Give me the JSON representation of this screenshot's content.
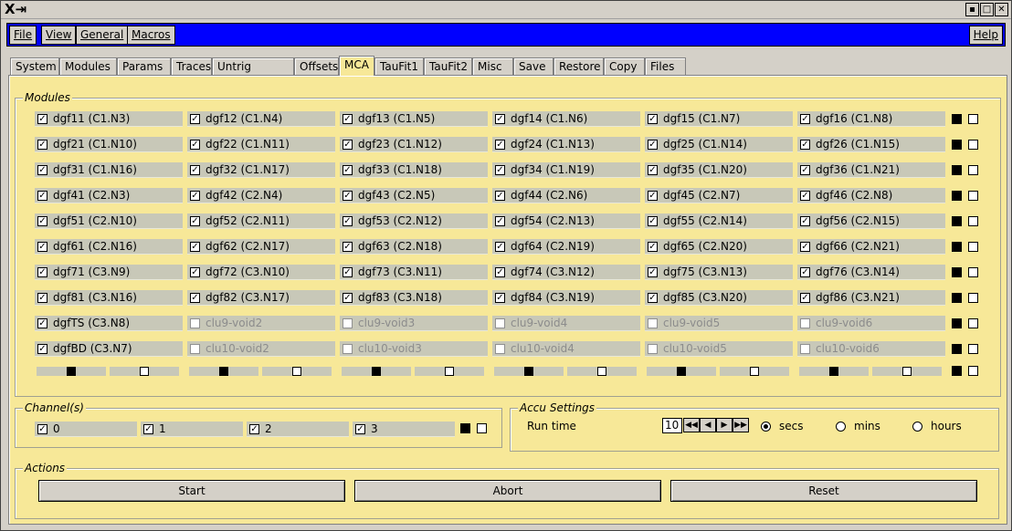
{
  "window": {
    "title_glyph": "X⇥",
    "ctl_iconify": "▪",
    "ctl_maximize": "□",
    "ctl_close": "✕"
  },
  "menubar": {
    "items": [
      {
        "label": "File"
      },
      {
        "label": "View"
      },
      {
        "label": "General"
      },
      {
        "label": "Macros"
      }
    ],
    "help": "Help"
  },
  "tabs": [
    {
      "label": "System"
    },
    {
      "label": "Modules"
    },
    {
      "label": "Params"
    },
    {
      "label": "Traces"
    },
    {
      "label": "Untrig Traces"
    },
    {
      "label": "Offsets"
    },
    {
      "label": "MCA",
      "active": true
    },
    {
      "label": "TauFit1"
    },
    {
      "label": "TauFit2"
    },
    {
      "label": "Misc"
    },
    {
      "label": "Save"
    },
    {
      "label": "Restore"
    },
    {
      "label": "Copy"
    },
    {
      "label": "Files"
    }
  ],
  "modules": {
    "legend": "Modules",
    "rows": [
      [
        {
          "label": "dgf11 (C1.N3)",
          "checked": true
        },
        {
          "label": "dgf12 (C1.N4)",
          "checked": true
        },
        {
          "label": "dgf13 (C1.N5)",
          "checked": true
        },
        {
          "label": "dgf14 (C1.N6)",
          "checked": true
        },
        {
          "label": "dgf15 (C1.N7)",
          "checked": true
        },
        {
          "label": "dgf16 (C1.N8)",
          "checked": true
        }
      ],
      [
        {
          "label": "dgf21 (C1.N10)",
          "checked": true
        },
        {
          "label": "dgf22 (C1.N11)",
          "checked": true
        },
        {
          "label": "dgf23 (C1.N12)",
          "checked": true
        },
        {
          "label": "dgf24 (C1.N13)",
          "checked": true
        },
        {
          "label": "dgf25 (C1.N14)",
          "checked": true
        },
        {
          "label": "dgf26 (C1.N15)",
          "checked": true
        }
      ],
      [
        {
          "label": "dgf31 (C1.N16)",
          "checked": true
        },
        {
          "label": "dgf32 (C1.N17)",
          "checked": true
        },
        {
          "label": "dgf33 (C1.N18)",
          "checked": true
        },
        {
          "label": "dgf34 (C1.N19)",
          "checked": true
        },
        {
          "label": "dgf35 (C1.N20)",
          "checked": true
        },
        {
          "label": "dgf36 (C1.N21)",
          "checked": true
        }
      ],
      [
        {
          "label": "dgf41 (C2.N3)",
          "checked": true
        },
        {
          "label": "dgf42 (C2.N4)",
          "checked": true
        },
        {
          "label": "dgf43 (C2.N5)",
          "checked": true
        },
        {
          "label": "dgf44 (C2.N6)",
          "checked": true
        },
        {
          "label": "dgf45 (C2.N7)",
          "checked": true
        },
        {
          "label": "dgf46 (C2.N8)",
          "checked": true
        }
      ],
      [
        {
          "label": "dgf51 (C2.N10)",
          "checked": true
        },
        {
          "label": "dgf52 (C2.N11)",
          "checked": true
        },
        {
          "label": "dgf53 (C2.N12)",
          "checked": true
        },
        {
          "label": "dgf54 (C2.N13)",
          "checked": true
        },
        {
          "label": "dgf55 (C2.N14)",
          "checked": true
        },
        {
          "label": "dgf56 (C2.N15)",
          "checked": true
        }
      ],
      [
        {
          "label": "dgf61 (C2.N16)",
          "checked": true
        },
        {
          "label": "dgf62 (C2.N17)",
          "checked": true
        },
        {
          "label": "dgf63 (C2.N18)",
          "checked": true
        },
        {
          "label": "dgf64 (C2.N19)",
          "checked": true
        },
        {
          "label": "dgf65 (C2.N20)",
          "checked": true
        },
        {
          "label": "dgf66 (C2.N21)",
          "checked": true
        }
      ],
      [
        {
          "label": "dgf71 (C3.N9)",
          "checked": true
        },
        {
          "label": "dgf72 (C3.N10)",
          "checked": true
        },
        {
          "label": "dgf73 (C3.N11)",
          "checked": true
        },
        {
          "label": "dgf74 (C3.N12)",
          "checked": true
        },
        {
          "label": "dgf75 (C3.N13)",
          "checked": true
        },
        {
          "label": "dgf76 (C3.N14)",
          "checked": true
        }
      ],
      [
        {
          "label": "dgf81 (C3.N16)",
          "checked": true
        },
        {
          "label": "dgf82 (C3.N17)",
          "checked": true
        },
        {
          "label": "dgf83 (C3.N18)",
          "checked": true
        },
        {
          "label": "dgf84 (C3.N19)",
          "checked": true
        },
        {
          "label": "dgf85 (C3.N20)",
          "checked": true
        },
        {
          "label": "dgf86 (C3.N21)",
          "checked": true
        }
      ],
      [
        {
          "label": "dgfTS (C3.N8)",
          "checked": true
        },
        {
          "label": "clu9-void2",
          "checked": false,
          "disabled": true
        },
        {
          "label": "clu9-void3",
          "checked": false,
          "disabled": true
        },
        {
          "label": "clu9-void4",
          "checked": false,
          "disabled": true
        },
        {
          "label": "clu9-void5",
          "checked": false,
          "disabled": true
        },
        {
          "label": "clu9-void6",
          "checked": false,
          "disabled": true
        }
      ],
      [
        {
          "label": "dgfBD (C3.N7)",
          "checked": true
        },
        {
          "label": "clu10-void2",
          "checked": false,
          "disabled": true
        },
        {
          "label": "clu10-void3",
          "checked": false,
          "disabled": true
        },
        {
          "label": "clu10-void4",
          "checked": false,
          "disabled": true
        },
        {
          "label": "clu10-void5",
          "checked": false,
          "disabled": true
        },
        {
          "label": "clu10-void6",
          "checked": false,
          "disabled": true
        }
      ]
    ]
  },
  "channels": {
    "legend": "Channel(s)",
    "items": [
      {
        "label": "0",
        "checked": true
      },
      {
        "label": "1",
        "checked": true
      },
      {
        "label": "2",
        "checked": true
      },
      {
        "label": "3",
        "checked": true
      }
    ]
  },
  "accu": {
    "legend": "Accu Settings",
    "run_time_label": "Run time",
    "run_time_value": "10",
    "spin_first": "◀◀",
    "spin_prev": "◀",
    "spin_next": "▶",
    "spin_last": "▶▶",
    "units": [
      {
        "label": "secs",
        "selected": true
      },
      {
        "label": "mins",
        "selected": false
      },
      {
        "label": "hours",
        "selected": false
      }
    ]
  },
  "actions": {
    "legend": "Actions",
    "buttons": [
      {
        "label": "Start"
      },
      {
        "label": "Abort"
      },
      {
        "label": "Reset"
      }
    ]
  },
  "check_glyph": "✓"
}
